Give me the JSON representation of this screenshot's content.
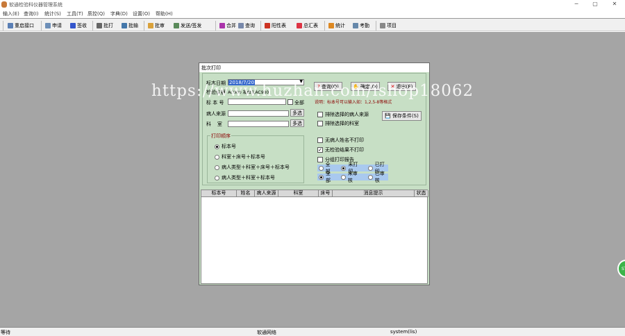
{
  "window": {
    "title": "软通检验科仪器管理系统",
    "controls": [
      "─",
      "▢",
      "✕"
    ]
  },
  "menu": [
    "输入(E)",
    "查询(I)",
    "统计(S)",
    "工具(T)",
    "质控(Q)",
    "字典(D)",
    "设置(O)",
    "帮助(H)"
  ],
  "toolbar": [
    {
      "label": "重启接口",
      "icon": "restart-icon",
      "color": "#5a7fb5"
    },
    {
      "label": "申请",
      "icon": "request-icon",
      "color": "#6d8fb8"
    },
    {
      "label": "签收",
      "icon": "sign-icon",
      "color": "#3355cc"
    },
    {
      "label": "批打",
      "icon": "print-icon",
      "color": "#666"
    },
    {
      "label": "批输",
      "icon": "batch-input-icon",
      "color": "#4477aa"
    },
    {
      "label": "批审",
      "icon": "audit-icon",
      "color": "#d9a13a"
    },
    {
      "label": "发送/签发",
      "icon": "send-icon",
      "color": "#5a8a5a"
    },
    {
      "label": "合并",
      "icon": "merge-icon",
      "color": "#aa33aa"
    },
    {
      "label": "查询",
      "icon": "query-icon",
      "color": "#7788aa"
    },
    {
      "label": "阳性表",
      "icon": "positive-icon",
      "color": "#cc3322"
    },
    {
      "label": "总汇表",
      "icon": "summary-icon",
      "color": "#dd3344"
    },
    {
      "label": "统计",
      "icon": "stats-icon",
      "color": "#dd8822"
    },
    {
      "label": "考勤",
      "icon": "attendance-icon",
      "color": "#6688aa"
    },
    {
      "label": "项目",
      "icon": "project-icon",
      "color": "#888"
    }
  ],
  "dialog": {
    "title": "批次打印",
    "sample_date_label": "标本日期",
    "sample_date": "2018/7/20",
    "instrument_label": "检验仪器",
    "instrument": "AC980 凝血仪AC980",
    "sample_no_label": "标 本 号",
    "sample_no": "",
    "all_label": "全部",
    "source_label": "病人来源",
    "source": "",
    "multi_label": "多选",
    "dept_label": "科    室",
    "dept": "",
    "order_group": "打印顺序",
    "order_options": [
      "标本号",
      "科室＋床号＋标本号",
      "病人类型＋科室＋床号＋标本号",
      "病人类型＋科室＋标本号"
    ],
    "order_selected": 0,
    "query_btn": "查询(Q)",
    "ok_btn": "确定(O)",
    "exit_btn": "退出(E)",
    "note": "说明：标本号可以输入如：1,2,5-8等格式",
    "note_color": "#8b0000",
    "save_btn": "保存条件(S)",
    "checks": [
      {
        "label": "排除选择的病人来源",
        "checked": false
      },
      {
        "label": "排除选择的科室",
        "checked": false
      },
      {
        "label": "无病人姓名不打印",
        "checked": false
      },
      {
        "label": "无检验结果不打印",
        "checked": true
      },
      {
        "label": "分组打印报告",
        "checked": false
      }
    ],
    "print_status": {
      "options": [
        "全部",
        "未打印",
        "已打印"
      ],
      "selected": 1
    },
    "audit_status": {
      "options": [
        "全部",
        "未审核",
        "已审核"
      ],
      "selected": 0
    },
    "grid_columns": [
      "标本号",
      "姓名",
      "病人来源",
      "科室",
      "床号",
      "消息提示",
      "状态"
    ]
  },
  "status": {
    "left": "等待",
    "center": "软通网络",
    "user": "system(lis)"
  },
  "watermark": "https://www.huzhan.com/ishop18062"
}
